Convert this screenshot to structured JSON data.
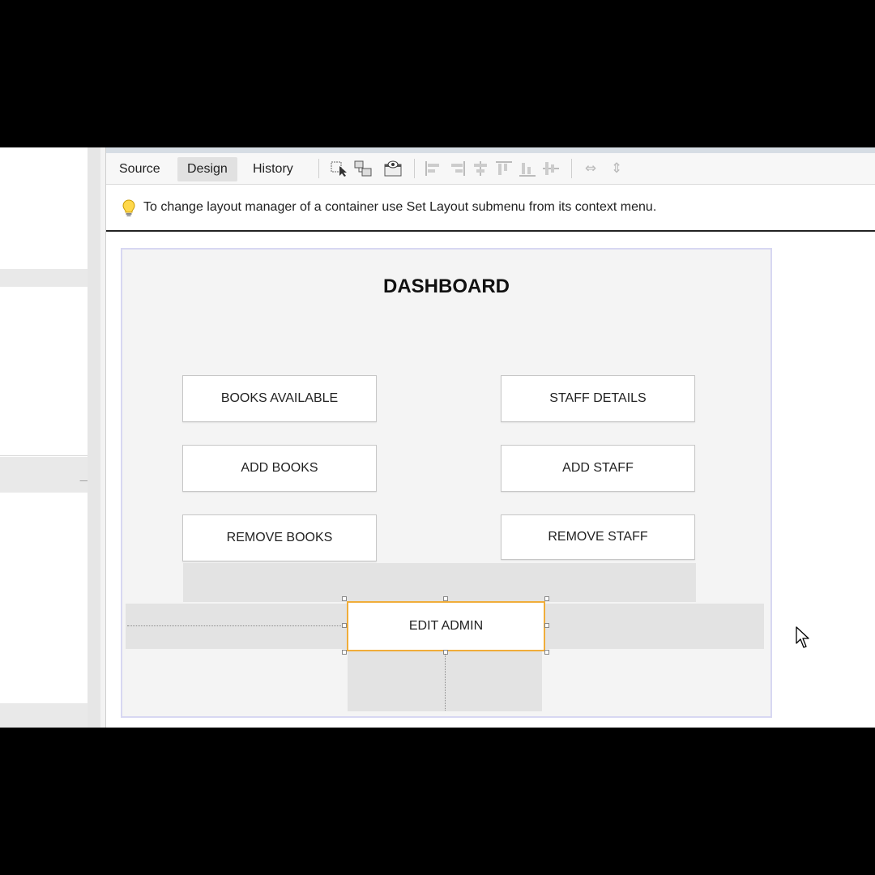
{
  "toolbar": {
    "tabs": [
      {
        "label": "Source"
      },
      {
        "label": "Design"
      },
      {
        "label": "History"
      }
    ],
    "active_tab": "Design",
    "icons": [
      "selection-mode-icon",
      "connection-mode-icon",
      "preview-design-icon",
      "align-left-icon",
      "align-right-icon",
      "center-horizontally-icon",
      "align-top-icon",
      "align-bottom-icon",
      "center-vertically-icon",
      "same-width-icon",
      "same-height-icon"
    ]
  },
  "hint": {
    "icon": "lightbulb-icon",
    "text": "To change layout manager of a container use Set Layout submenu from its context menu."
  },
  "form": {
    "title": "DASHBOARD",
    "buttons": {
      "books_available": "BOOKS AVAILABLE",
      "staff_details": "STAFF DETAILS",
      "add_books": "ADD BOOKS",
      "add_staff": "ADD STAFF",
      "remove_books": "REMOVE BOOKS",
      "remove_staff": "REMOVE STAFF",
      "edit_admin": "EDIT ADMIN"
    },
    "selected_component": "EDIT ADMIN"
  },
  "colors": {
    "selection": "#f0ad3a",
    "form_border": "#d7d7f2",
    "active_tab": "#e1e1e1"
  }
}
